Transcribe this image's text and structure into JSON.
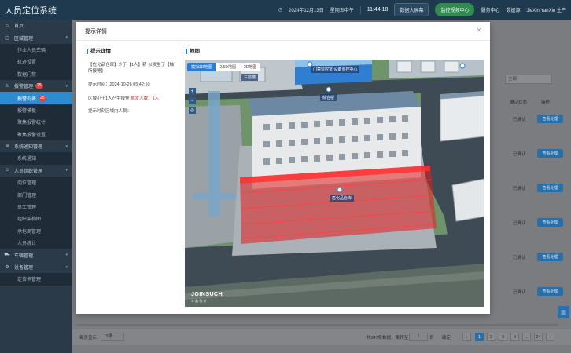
{
  "app": {
    "title": "人员定位系统"
  },
  "header": {
    "date": "2024年12月13日",
    "weekday": "星期五中午",
    "time": "11:44:18",
    "buttons": [
      "数据大屏幕",
      "监控视频中心",
      "服务中心",
      "数据源"
    ],
    "user": "JieXin YanXin 生产"
  },
  "sidebar": {
    "items": [
      {
        "label": "首页",
        "icon": "home-icon",
        "level": 0
      },
      {
        "label": "区域管理",
        "icon": "area-icon",
        "level": 0,
        "expandable": true
      },
      {
        "label": "作业人员车辆",
        "level": 1
      },
      {
        "label": "轨迹设置",
        "level": 1
      },
      {
        "label": "数据门禁",
        "level": 1
      },
      {
        "label": "报警管理",
        "icon": "alarm-icon",
        "level": 0,
        "badge": "25",
        "expandable": true
      },
      {
        "label": "报警列表",
        "level": 1,
        "badge": "25",
        "active": true
      },
      {
        "label": "报警模板",
        "level": 1
      },
      {
        "label": "聚集报警统计",
        "level": 1
      },
      {
        "label": "聚集报警设置",
        "level": 1
      },
      {
        "label": "系统通知管理",
        "icon": "notice-icon",
        "level": 0,
        "expandable": true
      },
      {
        "label": "系统通知",
        "level": 1
      },
      {
        "label": "人员组织管理",
        "icon": "user-icon",
        "level": 0,
        "expandable": true
      },
      {
        "label": "岗位管理",
        "level": 1
      },
      {
        "label": "部门管理",
        "level": 1
      },
      {
        "label": "员工管理",
        "level": 1
      },
      {
        "label": "组织架构图",
        "level": 1
      },
      {
        "label": "承包商管理",
        "level": 1
      },
      {
        "label": "人员统计",
        "level": 1
      },
      {
        "label": "车辆管理",
        "icon": "car-icon",
        "level": 0,
        "expandable": true
      },
      {
        "label": "设备管理",
        "icon": "device-icon",
        "level": 0,
        "expandable": true
      },
      {
        "label": "定位卡管理",
        "level": 1
      }
    ]
  },
  "background_table": {
    "filter_value": "全部",
    "columns": [
      "确认状态",
      "状态",
      "操作"
    ],
    "status_text": "已确认",
    "action_label": "查看处理",
    "pagination": {
      "page_size_label": "每页显示",
      "page_size": "15条",
      "total": "共347条数据，跳转至",
      "jump_value": "1",
      "jump_unit": "页",
      "confirm": "确定",
      "pages": [
        "1",
        "2",
        "3",
        "4",
        "...",
        "24"
      ],
      "current": "1"
    }
  },
  "modal": {
    "title": "提示详情",
    "detail_title": "提示详情",
    "detail_lines": [
      "【危化品仓库】少于【1人】精 以发生了【触 所报警】",
      "提示时间：2024-10-26 05:42:10"
    ],
    "rule_prefix": "区域小于1人产生报警 ",
    "rule_red": "触发人数：1人",
    "present_label": "提示时刻区域内人员：",
    "map_title": "地图",
    "map_tabs": [
      "模拟3D地图",
      "2.5D地图",
      "2D地图"
    ],
    "map_labels": {
      "building_top": "门禁监控室 设备监控中心",
      "building_main": "综合楼",
      "warehouse": "危化品仓库",
      "other": "三层楼"
    },
    "map_logo": "JOINSUCH",
    "map_logo_sub": "众 鑫 科 技"
  },
  "colors": {
    "header_bg": "#1f3a4e",
    "sidebar_bg": "#2a3a48",
    "accent": "#2d7cd0",
    "alarm_red": "#e0302b"
  }
}
